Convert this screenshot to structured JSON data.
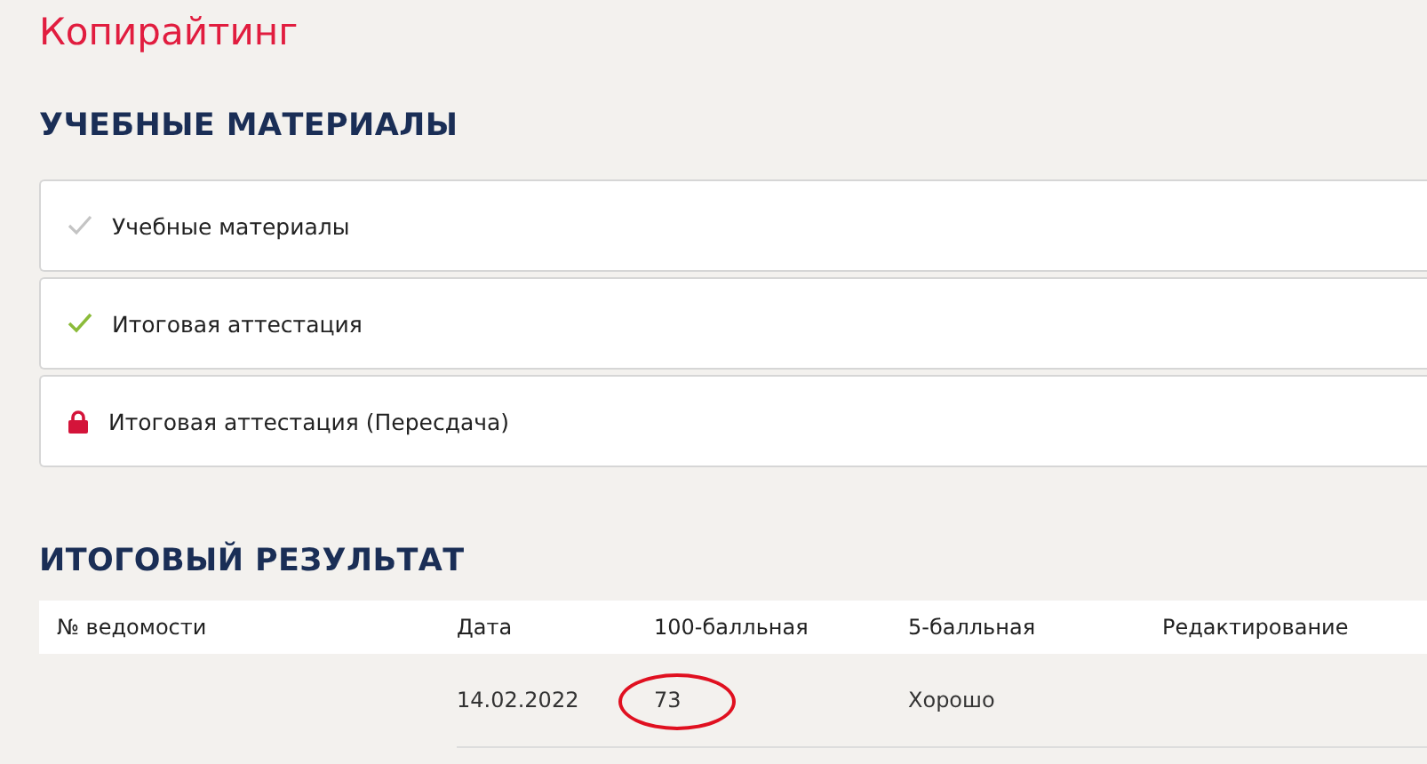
{
  "course_title": "Копирайтинг",
  "materials": {
    "heading": "УЧЕБНЫЕ МАТЕРИАЛЫ",
    "items": [
      {
        "label": "Учебные материалы",
        "kind": "viewed"
      },
      {
        "label": "Итоговая аттестация",
        "kind": "passed"
      },
      {
        "label": "Итоговая аттестация (Пересдача)",
        "kind": "locked"
      }
    ]
  },
  "result": {
    "heading": "ИТОГОВЫЙ РЕЗУЛЬТАТ",
    "table": {
      "columns": [
        "№ ведомости",
        "Дата",
        "100-балльная",
        "5-балльная",
        "Редактирование"
      ],
      "rows": [
        {
          "date": {
            "text": "14.02.2022",
            "circled": false
          },
          "score_100": {
            "text": "73",
            "circled": true
          },
          "score_5": {
            "text": "Хорошо",
            "circled": false
          }
        }
      ]
    }
  }
}
